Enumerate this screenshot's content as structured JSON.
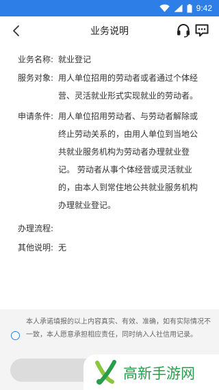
{
  "status_bar": {
    "time": "9:42",
    "icons": [
      "wifi-icon",
      "signal-icon",
      "battery-icon"
    ]
  },
  "header": {
    "back_icon": "chevron-left-icon",
    "title": "业务说明",
    "actions": [
      "headset-icon",
      "chat-bubble-icon"
    ]
  },
  "details": {
    "name_label": "业务名称:",
    "name_value": "就业登记",
    "target_label": "服务对象:",
    "target_value": "用人单位招用的劳动者或者通过个体经营、灵活就业形式实现就业的劳动者。",
    "conditions_label": "申请条件:",
    "conditions_value": "用人单位招用劳动者、与劳动者解除或终止劳动关系的，由用人单位到当地公共就业服务机构为劳动者办理就业登记。 劳动者从事个体经营或灵活就业的，由本人到常住地公共就业服务机构办理就业登记。",
    "process_label": "办理流程:",
    "process_value": "",
    "other_label": "其他说明:",
    "other_value": "无"
  },
  "agreement": {
    "text": "本人承诺填报的以上内容真实、有效、准确，如有实际情况不一致，本人愿意承担相应责任，同时纳入人社信用记录。",
    "checked": false
  },
  "watermark": {
    "text": "高新手游网"
  },
  "colors": {
    "primary": "#2d7ee6",
    "watermark_green": "#2a9d4a"
  }
}
